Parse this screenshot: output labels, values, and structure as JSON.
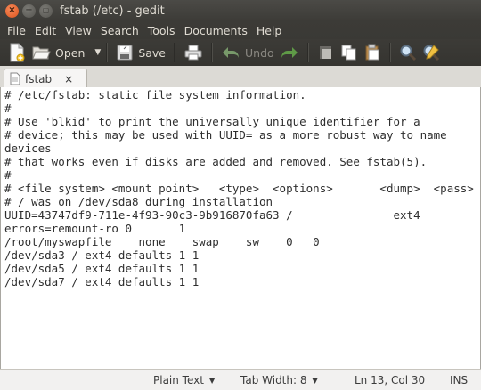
{
  "window": {
    "title": "fstab (/etc) - gedit"
  },
  "menubar": {
    "items": [
      "File",
      "Edit",
      "View",
      "Search",
      "Tools",
      "Documents",
      "Help"
    ]
  },
  "toolbar": {
    "open_label": "Open",
    "save_label": "Save",
    "undo_label": "Undo",
    "icons": [
      "new-document-icon",
      "open-icon",
      "save-icon",
      "print-icon",
      "undo-icon",
      "redo-icon",
      "cut-icon",
      "copy-icon",
      "paste-icon",
      "find-icon",
      "replace-icon"
    ]
  },
  "tabs": [
    {
      "label": "fstab",
      "close": "×"
    }
  ],
  "editor": {
    "lines": [
      "# /etc/fstab: static file system information.",
      "#",
      "# Use 'blkid' to print the universally unique identifier for a",
      "# device; this may be used with UUID= as a more robust way to name",
      "devices",
      "# that works even if disks are added and removed. See fstab(5).",
      "#",
      "# <file system> <mount point>   <type>  <options>       <dump>  <pass>",
      "# / was on /dev/sda8 during installation",
      "UUID=43747df9-711e-4f93-90c3-9b916870fa63 /               ext4",
      "errors=remount-ro 0       1",
      "/root/myswapfile    none    swap    sw    0   0",
      "/dev/sda3 / ext4 defaults 1 1",
      "/dev/sda5 / ext4 defaults 1 1",
      "/dev/sda7 / ext4 defaults 1 1"
    ]
  },
  "statusbar": {
    "language": "Plain Text",
    "tab_width": "Tab Width: 8",
    "position": "Ln 13, Col 30",
    "mode": "INS"
  },
  "colors": {
    "titlebar": "#3c3b37",
    "close_button": "#e0531c",
    "editor_bg": "#ffffff"
  }
}
